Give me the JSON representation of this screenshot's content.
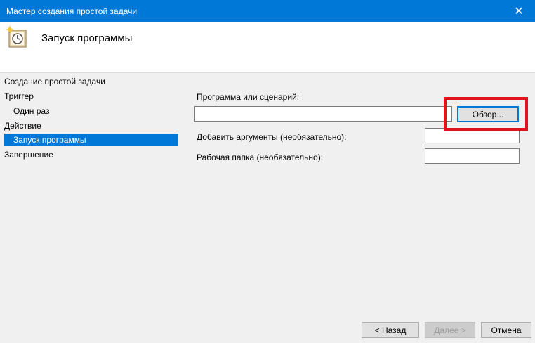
{
  "window": {
    "title": "Мастер создания простой задачи",
    "close_glyph": "✕"
  },
  "header": {
    "title": "Запуск программы",
    "icon": "task-clock-icon"
  },
  "sidebar": {
    "items": [
      {
        "label": "Создание простой задачи"
      },
      {
        "label": "Триггер"
      },
      {
        "label": "Один раз"
      },
      {
        "label": "Действие"
      },
      {
        "label": "Запуск программы",
        "selected": true
      },
      {
        "label": "Завершение"
      }
    ]
  },
  "form": {
    "program": {
      "label": "Программа или сценарий:",
      "value": ""
    },
    "browse_label": "Обзор...",
    "arguments": {
      "label": "Добавить аргументы (необязательно):",
      "value": ""
    },
    "workdir": {
      "label": "Рабочая папка (необязательно):",
      "value": ""
    }
  },
  "footer": {
    "back_label": "< Назад",
    "next_label": "Далее >",
    "cancel_label": "Отмена"
  },
  "colors": {
    "accent": "#0078d7",
    "highlight": "#e0141e"
  }
}
